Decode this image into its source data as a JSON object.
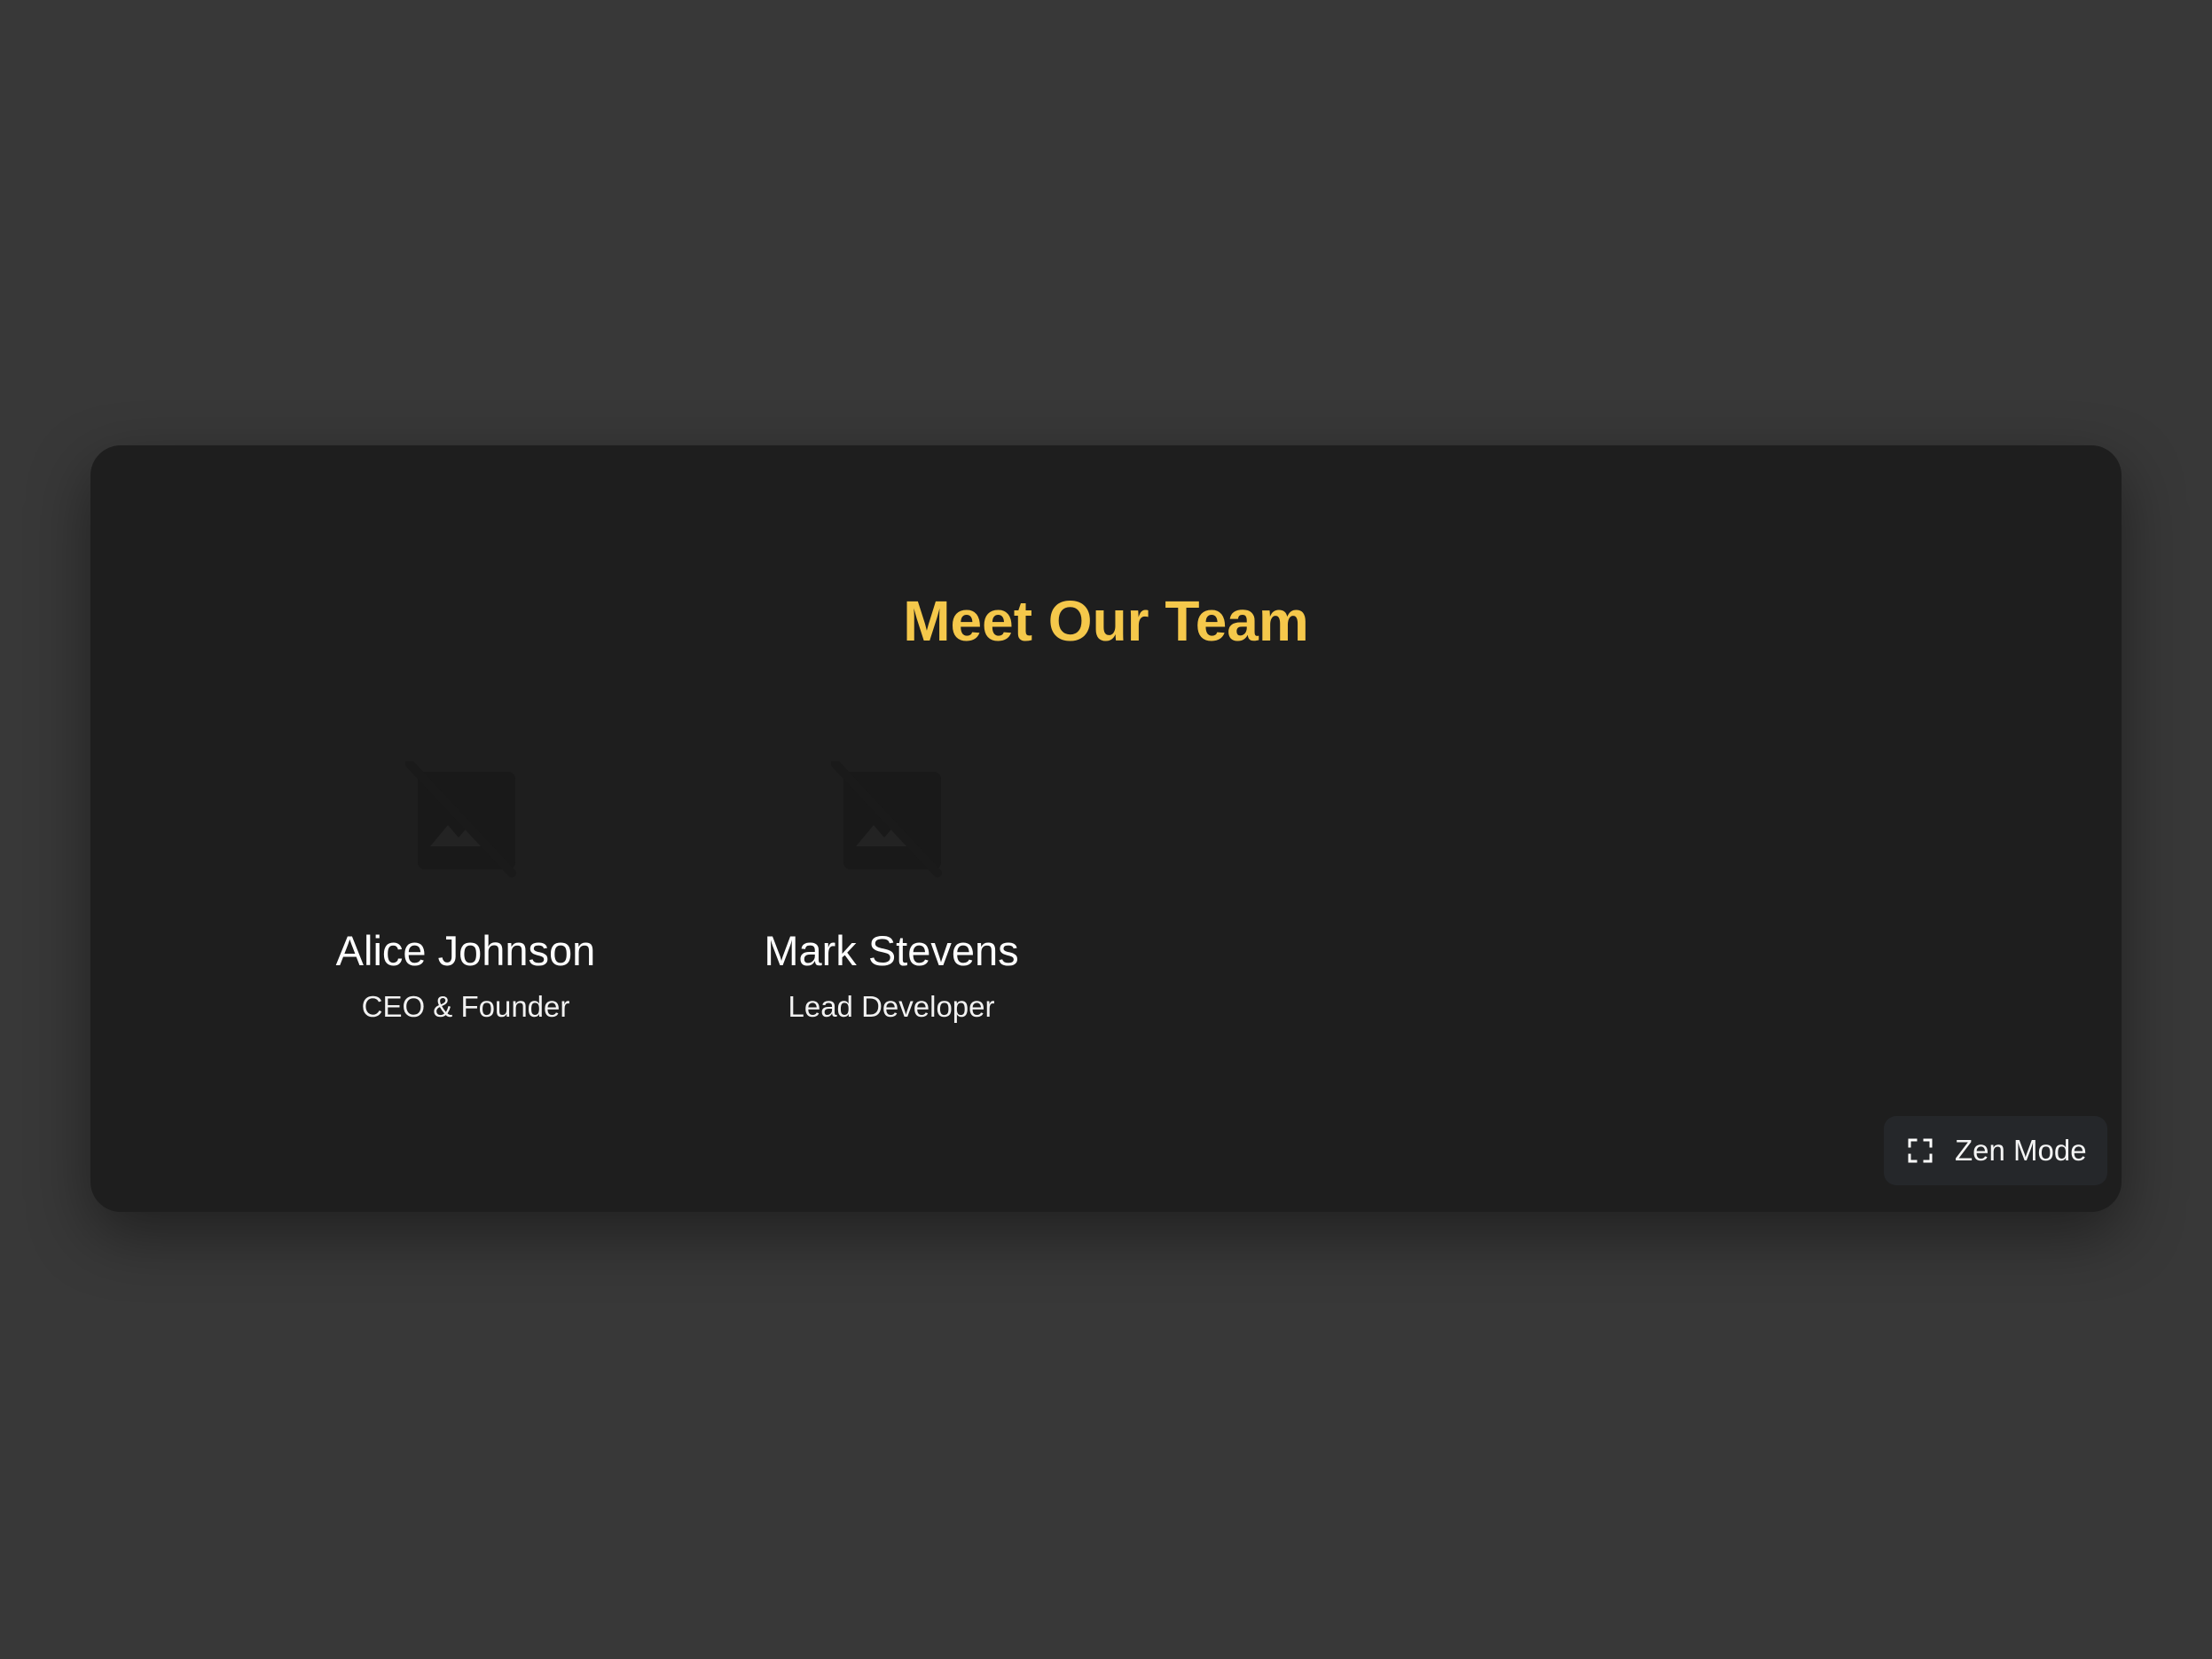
{
  "page": {
    "title": "Meet Our Team"
  },
  "team": [
    {
      "name": "Alice Johnson",
      "role": "CEO & Founder",
      "photo_icon": "image-unavailable-icon"
    },
    {
      "name": "Mark Stevens",
      "role": "Lead Developer",
      "photo_icon": "image-unavailable-icon"
    }
  ],
  "zen_mode": {
    "label": "Zen Mode",
    "icon": "fullscreen-icon"
  },
  "colors": {
    "background": "#383838",
    "card": "#1e1e1e",
    "accent": "#f5c84b",
    "button": "#25272a",
    "text": "#ffffff"
  }
}
